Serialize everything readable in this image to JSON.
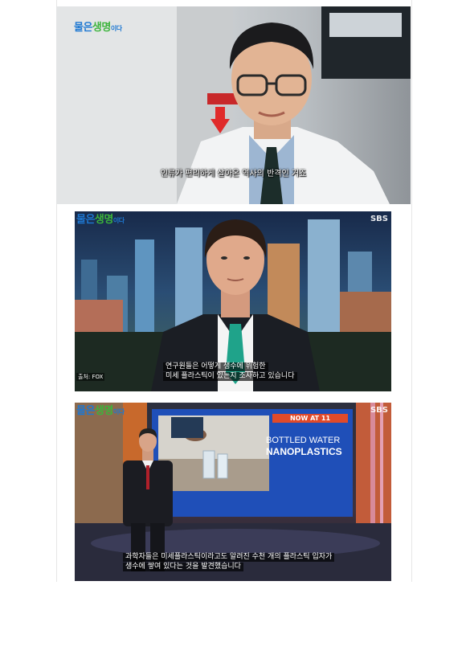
{
  "frame1": {
    "logo": {
      "part1": "물은",
      "part2": "생명",
      "part3": "이다"
    },
    "subtitle": "인류가 편리하게 살아온 역사의 반격인 거죠"
  },
  "frame2": {
    "logo": {
      "part1": "물은",
      "part2": "생명",
      "part3": "이다"
    },
    "broadcaster": "SBS",
    "source": "출처: FOX",
    "subtitle_line1": "연구원들은 어떻게 생수에 위험한",
    "subtitle_line2": "미세 플라스틱이 있는지 조사하고 있습니다"
  },
  "frame3": {
    "logo": {
      "part1": "물은",
      "part2": "생명",
      "part3": "이다"
    },
    "broadcaster": "SBS",
    "now_label": "NOW AT 11",
    "headline_line1": "BOTTLED WATER",
    "headline_line2": "NANOPLASTICS",
    "subtitle_line1": "과학자들은 미세플라스틱이라고도 알려진 수천 개의 플라스틱 입자가",
    "subtitle_line2": "생수에 쌓여 있다는 것을 발견했습니다"
  },
  "colors": {
    "logo_blue": "#1e78d2",
    "logo_green": "#3cb43c",
    "news_blue": "#1f4fb8",
    "now_red": "#e04a2a"
  }
}
